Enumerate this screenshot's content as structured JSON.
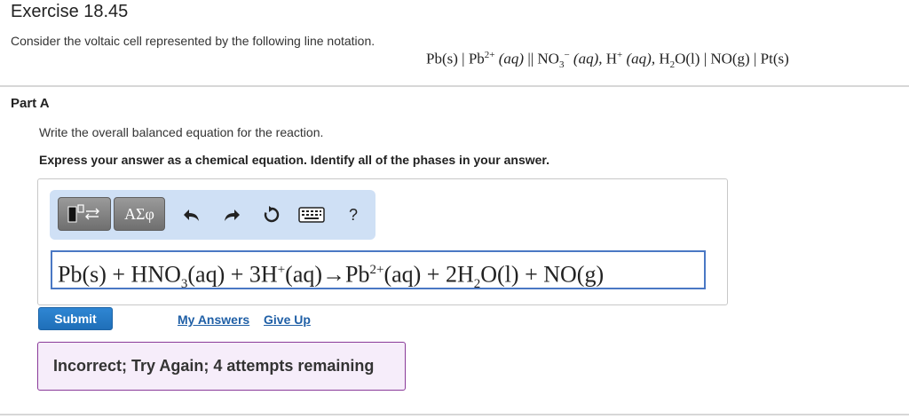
{
  "header": {
    "title": "Exercise 18.45"
  },
  "intro": {
    "text": "Consider the voltaic cell represented by the following line notation.",
    "notation": {
      "pb_s": "Pb(s)",
      "sep1": "|",
      "pb2_base": "Pb",
      "pb2_charge": "2+",
      "pb2_phase": "(aq)",
      "salt_bridge": "||",
      "no3_base": "NO",
      "no3_sub": "3",
      "no3_charge": "−",
      "no3_phase": "(aq),",
      "h_base": "H",
      "h_charge": "+",
      "h_phase": "(aq),",
      "h2o_a": "H",
      "h2o_sub": "2",
      "h2o_b": "O(l)",
      "sep2": "|",
      "no_g": "NO(g)",
      "sep3": "|",
      "pt_s": "Pt(s)"
    }
  },
  "partA": {
    "label": "Part A",
    "instruction": "Write the overall balanced equation for the reaction.",
    "requirement": "Express your answer as a chemical equation. Identify all of the phases in your answer."
  },
  "toolbar": {
    "greek_label": "ΑΣφ",
    "help_label": "?",
    "icons": [
      "templates-icon",
      "undo-icon",
      "redo-icon",
      "reset-icon",
      "keyboard-icon",
      "help-icon"
    ]
  },
  "answer": {
    "p1": "Pb(s) + HNO",
    "s1": "3",
    "p2": "(aq) + 3H",
    "c1": "+",
    "p3": "(aq)→Pb",
    "c2": "2+",
    "p4": "(aq) + 2H",
    "s2": "2",
    "p5": "O(l) + NO(g)"
  },
  "actions": {
    "submit_label": "Submit",
    "my_answers_label": "My Answers",
    "give_up_label": "Give Up"
  },
  "feedback": {
    "text": "Incorrect; Try Again; 4 attempts remaining"
  },
  "colors": {
    "accent": "#1f6fb8",
    "toolbar_bg": "#cfe0f5",
    "input_border": "#4a78c4",
    "feedback_bg": "#f6edfa",
    "feedback_border": "#8a3a99",
    "link": "#1f5fa6"
  }
}
